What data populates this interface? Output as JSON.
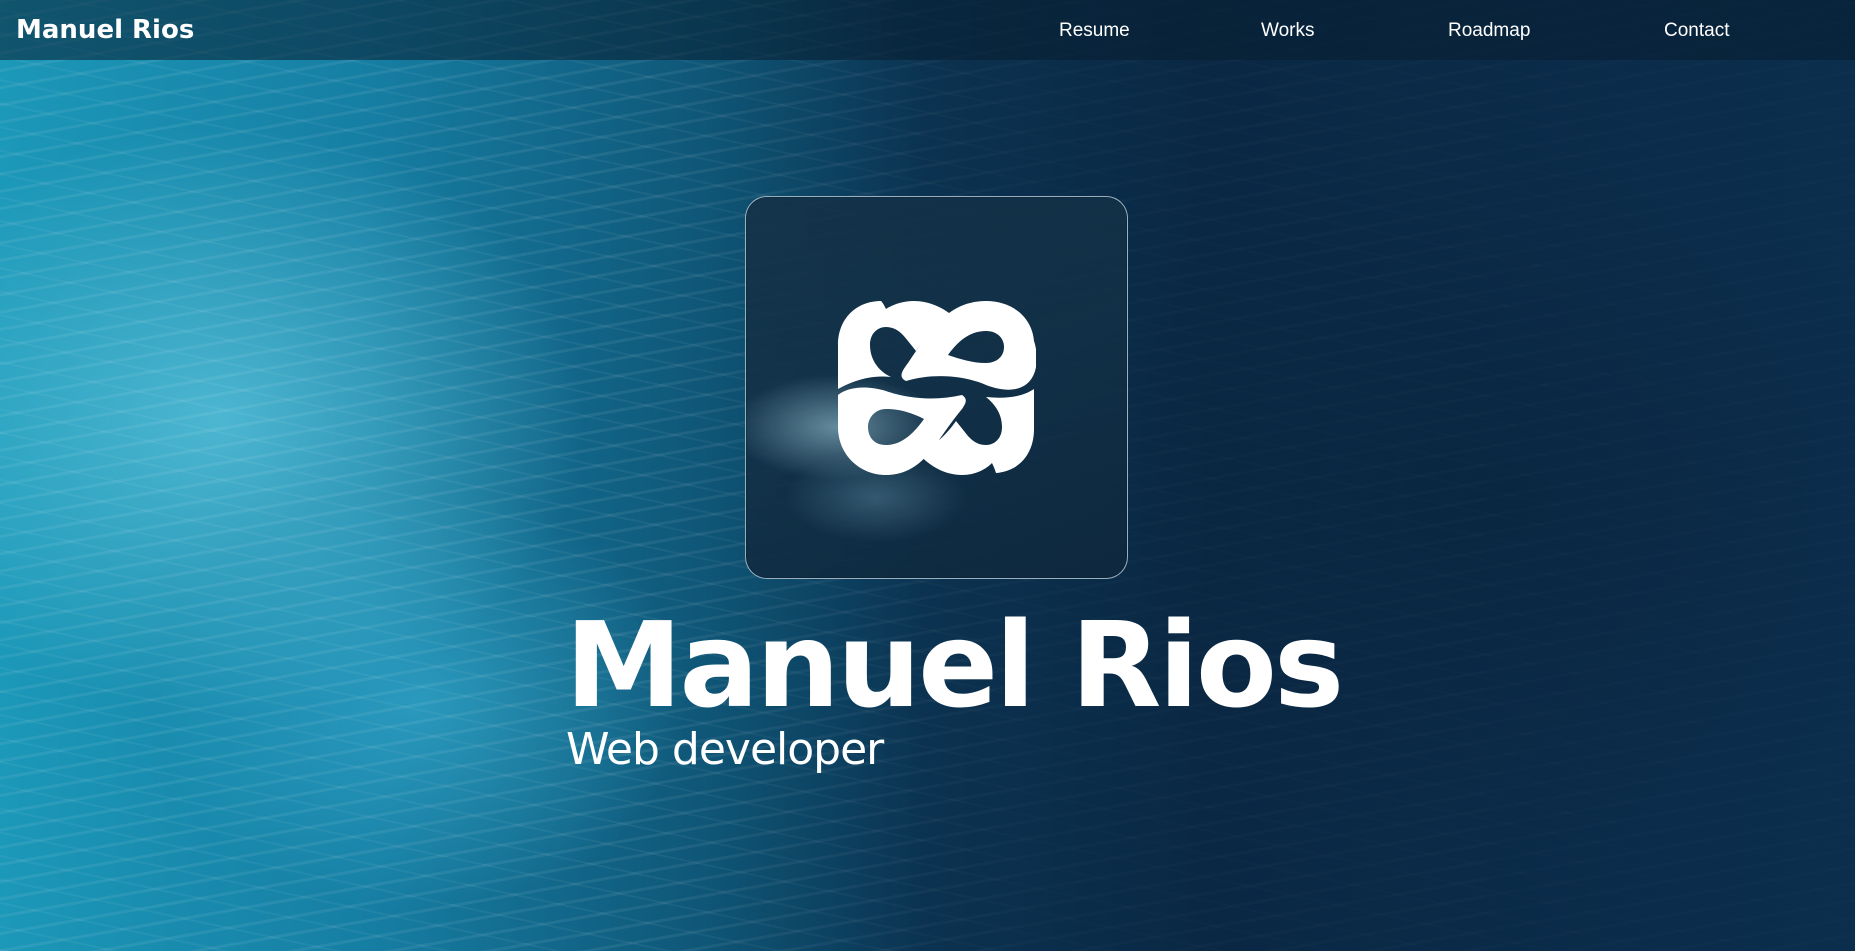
{
  "header": {
    "brand": "Manuel Rios",
    "nav": [
      {
        "label": "Resume"
      },
      {
        "label": "Works"
      },
      {
        "label": "Roadmap"
      },
      {
        "label": "Contact"
      }
    ]
  },
  "hero": {
    "logo_icon": "infinity-knot-logo-icon",
    "name": "Manuel Rios",
    "role": "Web developer"
  },
  "background": {
    "image": "ocean-waves-background",
    "accent_light": "#1c98b8",
    "accent_dark": "#0a2844"
  }
}
